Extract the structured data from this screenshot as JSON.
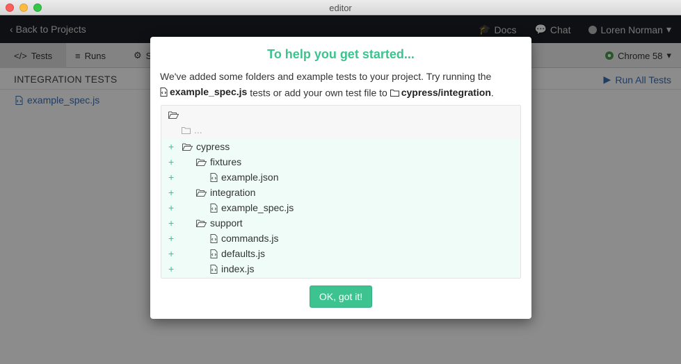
{
  "window": {
    "title": "editor"
  },
  "topnav": {
    "back_label": "Back to Projects",
    "docs_label": "Docs",
    "chat_label": "Chat",
    "user_name": "Loren Norman"
  },
  "tabs": [
    {
      "label": "Tests",
      "active": true
    },
    {
      "label": "Runs",
      "active": false
    },
    {
      "label": "S",
      "active": false
    }
  ],
  "browser": {
    "label": "Chrome 58"
  },
  "content": {
    "section_title": "INTEGRATION TESTS",
    "run_all_label": "Run All Tests",
    "spec_file": "example_spec.js"
  },
  "modal": {
    "title": "To help you get started...",
    "intro_text": "We've added some folders and example tests to your project. Try running the",
    "spec_name": "example_spec.js",
    "middle_text": "tests or add your own test file to",
    "folder_name": "cypress/integration",
    "end_text": ".",
    "existing_placeholder": "...",
    "tree": [
      {
        "name": "cypress",
        "type": "folder",
        "depth": 0
      },
      {
        "name": "fixtures",
        "type": "folder",
        "depth": 1
      },
      {
        "name": "example.json",
        "type": "file",
        "depth": 2
      },
      {
        "name": "integration",
        "type": "folder",
        "depth": 1
      },
      {
        "name": "example_spec.js",
        "type": "file",
        "depth": 2
      },
      {
        "name": "support",
        "type": "folder",
        "depth": 1
      },
      {
        "name": "commands.js",
        "type": "file",
        "depth": 2
      },
      {
        "name": "defaults.js",
        "type": "file",
        "depth": 2
      },
      {
        "name": "index.js",
        "type": "file",
        "depth": 2
      }
    ],
    "added_marker": "+",
    "ok_label": "OK, got it!"
  },
  "colors": {
    "accent": "#3cc38f",
    "link": "#3b6fb6",
    "nav_bg": "#1b1e24"
  }
}
